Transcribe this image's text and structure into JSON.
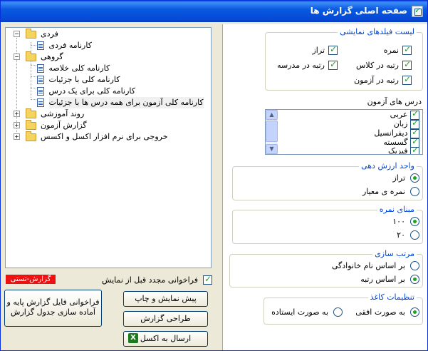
{
  "window": {
    "title": "صفحه اصلی گزارش ها"
  },
  "tree": {
    "individual": {
      "label": "فردی",
      "children": [
        "کارنامه فردی"
      ]
    },
    "group": {
      "label": "گروهی",
      "children": [
        "کارنامه کلی خلاصه",
        "کارنامه کلی با جزئیات",
        "کارنامه کلی برای یک درس",
        "کارنامه کلی آزمون برای همه درس ها با جزئیات"
      ]
    },
    "others": [
      "روند آموزشی",
      "گزارش آزمون",
      "خروجی برای نرم افزار اکسل و اکسس"
    ]
  },
  "display_fields": {
    "title": "لیست فیلدهای نمایشی",
    "items": [
      {
        "label": "نمره",
        "checked": true
      },
      {
        "label": "تراز",
        "checked": true
      },
      {
        "label": "رتبه در کلاس",
        "checked": true
      },
      {
        "label": "رتبه در مدرسه",
        "checked": true
      },
      {
        "label": "رتبه در آزمون",
        "checked": true
      }
    ]
  },
  "courses": {
    "title": "درس های آزمون",
    "items": [
      "عربی",
      "زبان",
      "دیفرانسیل",
      "گسسته",
      "فیزیک"
    ]
  },
  "unit": {
    "title": "واحد ارزش دهی",
    "options": [
      "تراز",
      "نمره ی معیار"
    ],
    "selected": 0
  },
  "base": {
    "title": "مبنای نمره",
    "options": [
      "۱۰۰",
      "۲۰"
    ],
    "selected": 0
  },
  "sort": {
    "title": "مرتب سازی",
    "options": [
      "بر اساس نام خانوادگی",
      "بر اساس رتبه"
    ],
    "selected": 1
  },
  "paper": {
    "title": "تنظیمات کاغذ",
    "options": [
      "به صورت افقی",
      "به صورت ایستاده"
    ],
    "selected": 0
  },
  "bottom": {
    "recall_label": "فراخوانی مجدد قبل از نمایش",
    "status": "گزارش-تستی",
    "preview_label": "پیش نمایش و چاپ",
    "design_label": "طراحی گزارش",
    "excel_label": "ارسال به اکسل",
    "load_line1": "فراخوانی فایل گزارش پایه و",
    "load_line2": "آماده سازی جدول گزارش"
  },
  "colors": {
    "accent": "#0046d5",
    "title_bar": "#0a5ae0",
    "badge": "#ee1111",
    "check": "#21a121"
  },
  "icons": {
    "window": "checklist-icon",
    "folder": "folder-icon",
    "doc": "document-icon",
    "excel": "excel-icon"
  }
}
